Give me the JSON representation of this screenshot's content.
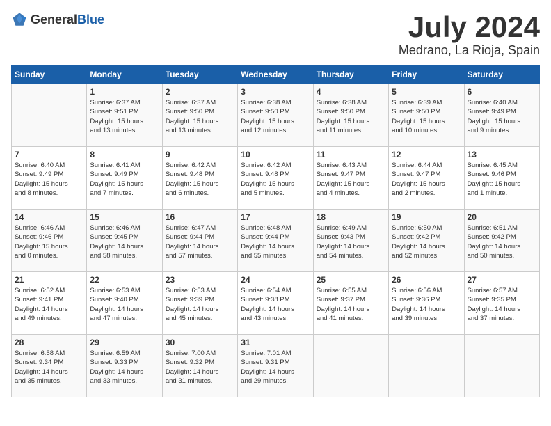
{
  "header": {
    "logo_general": "General",
    "logo_blue": "Blue",
    "month_year": "July 2024",
    "location": "Medrano, La Rioja, Spain"
  },
  "days_of_week": [
    "Sunday",
    "Monday",
    "Tuesday",
    "Wednesday",
    "Thursday",
    "Friday",
    "Saturday"
  ],
  "weeks": [
    [
      {
        "day": "",
        "content": ""
      },
      {
        "day": "1",
        "content": "Sunrise: 6:37 AM\nSunset: 9:51 PM\nDaylight: 15 hours\nand 13 minutes."
      },
      {
        "day": "2",
        "content": "Sunrise: 6:37 AM\nSunset: 9:50 PM\nDaylight: 15 hours\nand 13 minutes."
      },
      {
        "day": "3",
        "content": "Sunrise: 6:38 AM\nSunset: 9:50 PM\nDaylight: 15 hours\nand 12 minutes."
      },
      {
        "day": "4",
        "content": "Sunrise: 6:38 AM\nSunset: 9:50 PM\nDaylight: 15 hours\nand 11 minutes."
      },
      {
        "day": "5",
        "content": "Sunrise: 6:39 AM\nSunset: 9:50 PM\nDaylight: 15 hours\nand 10 minutes."
      },
      {
        "day": "6",
        "content": "Sunrise: 6:40 AM\nSunset: 9:49 PM\nDaylight: 15 hours\nand 9 minutes."
      }
    ],
    [
      {
        "day": "7",
        "content": "Sunrise: 6:40 AM\nSunset: 9:49 PM\nDaylight: 15 hours\nand 8 minutes."
      },
      {
        "day": "8",
        "content": "Sunrise: 6:41 AM\nSunset: 9:49 PM\nDaylight: 15 hours\nand 7 minutes."
      },
      {
        "day": "9",
        "content": "Sunrise: 6:42 AM\nSunset: 9:48 PM\nDaylight: 15 hours\nand 6 minutes."
      },
      {
        "day": "10",
        "content": "Sunrise: 6:42 AM\nSunset: 9:48 PM\nDaylight: 15 hours\nand 5 minutes."
      },
      {
        "day": "11",
        "content": "Sunrise: 6:43 AM\nSunset: 9:47 PM\nDaylight: 15 hours\nand 4 minutes."
      },
      {
        "day": "12",
        "content": "Sunrise: 6:44 AM\nSunset: 9:47 PM\nDaylight: 15 hours\nand 2 minutes."
      },
      {
        "day": "13",
        "content": "Sunrise: 6:45 AM\nSunset: 9:46 PM\nDaylight: 15 hours\nand 1 minute."
      }
    ],
    [
      {
        "day": "14",
        "content": "Sunrise: 6:46 AM\nSunset: 9:46 PM\nDaylight: 15 hours\nand 0 minutes."
      },
      {
        "day": "15",
        "content": "Sunrise: 6:46 AM\nSunset: 9:45 PM\nDaylight: 14 hours\nand 58 minutes."
      },
      {
        "day": "16",
        "content": "Sunrise: 6:47 AM\nSunset: 9:44 PM\nDaylight: 14 hours\nand 57 minutes."
      },
      {
        "day": "17",
        "content": "Sunrise: 6:48 AM\nSunset: 9:44 PM\nDaylight: 14 hours\nand 55 minutes."
      },
      {
        "day": "18",
        "content": "Sunrise: 6:49 AM\nSunset: 9:43 PM\nDaylight: 14 hours\nand 54 minutes."
      },
      {
        "day": "19",
        "content": "Sunrise: 6:50 AM\nSunset: 9:42 PM\nDaylight: 14 hours\nand 52 minutes."
      },
      {
        "day": "20",
        "content": "Sunrise: 6:51 AM\nSunset: 9:42 PM\nDaylight: 14 hours\nand 50 minutes."
      }
    ],
    [
      {
        "day": "21",
        "content": "Sunrise: 6:52 AM\nSunset: 9:41 PM\nDaylight: 14 hours\nand 49 minutes."
      },
      {
        "day": "22",
        "content": "Sunrise: 6:53 AM\nSunset: 9:40 PM\nDaylight: 14 hours\nand 47 minutes."
      },
      {
        "day": "23",
        "content": "Sunrise: 6:53 AM\nSunset: 9:39 PM\nDaylight: 14 hours\nand 45 minutes."
      },
      {
        "day": "24",
        "content": "Sunrise: 6:54 AM\nSunset: 9:38 PM\nDaylight: 14 hours\nand 43 minutes."
      },
      {
        "day": "25",
        "content": "Sunrise: 6:55 AM\nSunset: 9:37 PM\nDaylight: 14 hours\nand 41 minutes."
      },
      {
        "day": "26",
        "content": "Sunrise: 6:56 AM\nSunset: 9:36 PM\nDaylight: 14 hours\nand 39 minutes."
      },
      {
        "day": "27",
        "content": "Sunrise: 6:57 AM\nSunset: 9:35 PM\nDaylight: 14 hours\nand 37 minutes."
      }
    ],
    [
      {
        "day": "28",
        "content": "Sunrise: 6:58 AM\nSunset: 9:34 PM\nDaylight: 14 hours\nand 35 minutes."
      },
      {
        "day": "29",
        "content": "Sunrise: 6:59 AM\nSunset: 9:33 PM\nDaylight: 14 hours\nand 33 minutes."
      },
      {
        "day": "30",
        "content": "Sunrise: 7:00 AM\nSunset: 9:32 PM\nDaylight: 14 hours\nand 31 minutes."
      },
      {
        "day": "31",
        "content": "Sunrise: 7:01 AM\nSunset: 9:31 PM\nDaylight: 14 hours\nand 29 minutes."
      },
      {
        "day": "",
        "content": ""
      },
      {
        "day": "",
        "content": ""
      },
      {
        "day": "",
        "content": ""
      }
    ]
  ]
}
